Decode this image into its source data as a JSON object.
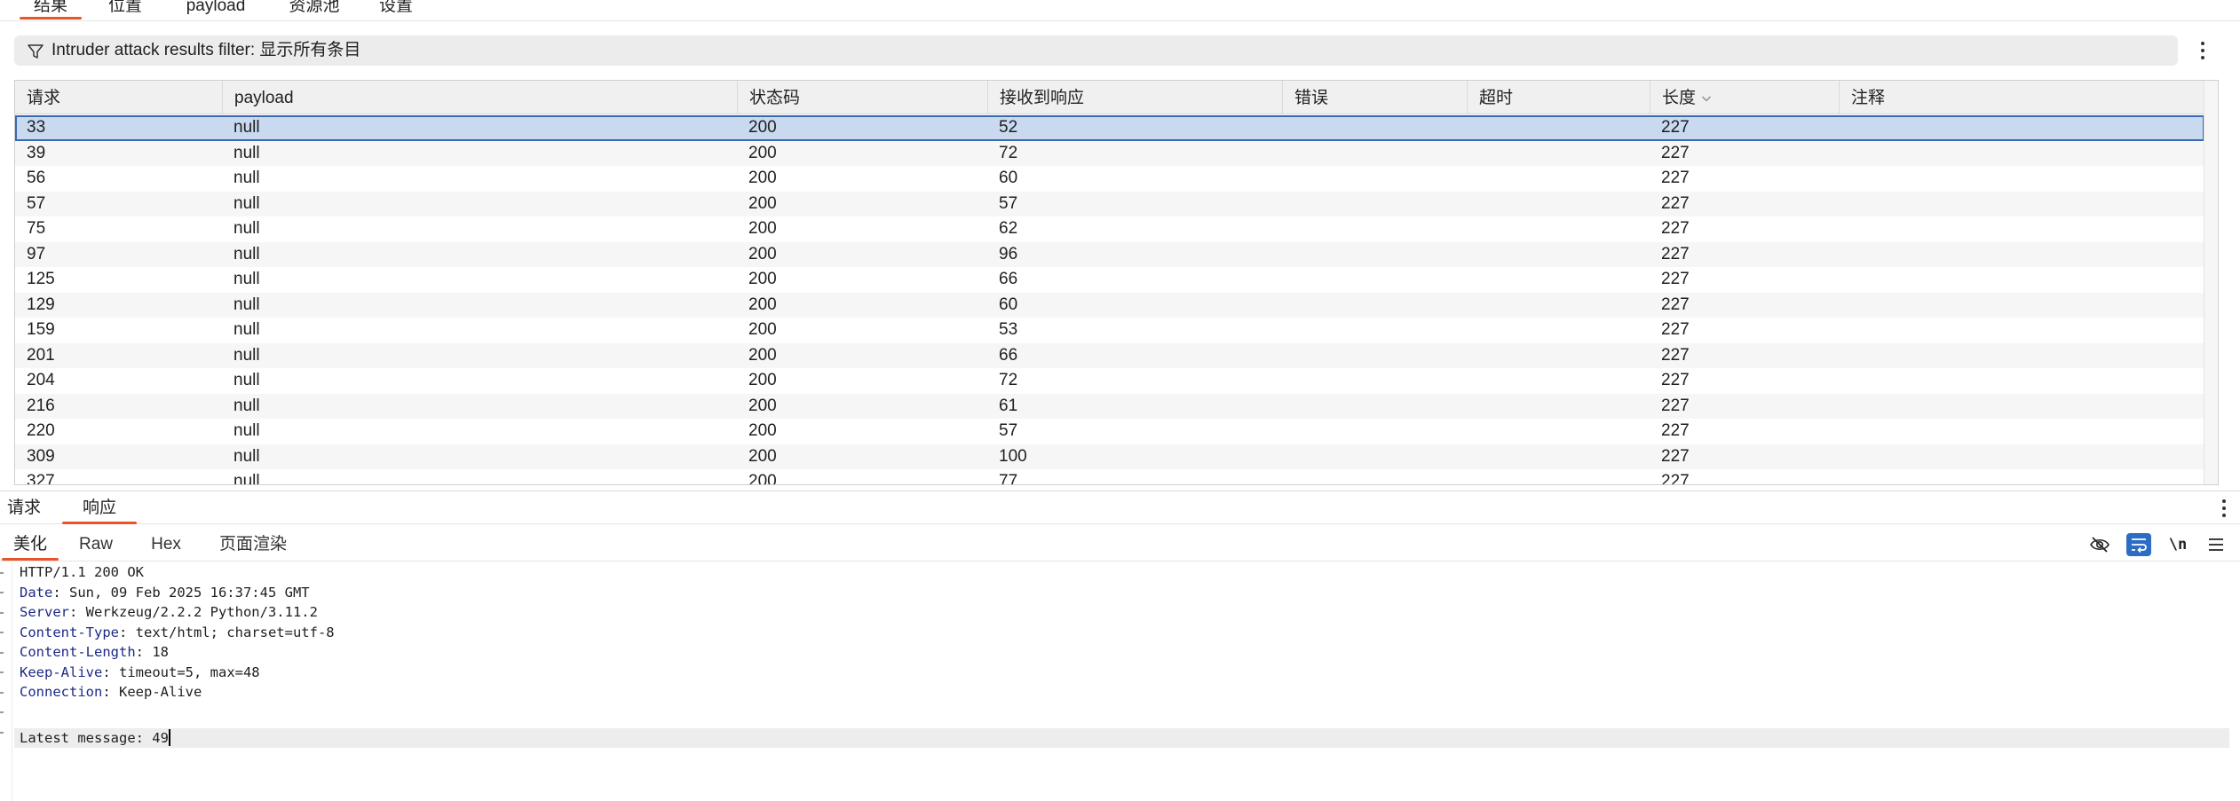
{
  "top_tabs": [
    {
      "label": "结果",
      "active": true
    },
    {
      "label": "位置",
      "active": false
    },
    {
      "label": "payload",
      "active": false
    },
    {
      "label": "资源池",
      "active": false
    },
    {
      "label": "设置",
      "active": false
    }
  ],
  "filter": {
    "text": "Intruder attack results filter: 显示所有条目",
    "icon": "filter-icon"
  },
  "table": {
    "columns": [
      "请求",
      "payload",
      "状态码",
      "接收到响应",
      "错误",
      "超时",
      "长度",
      "注释"
    ],
    "sorted_column": "长度",
    "rows": [
      {
        "request": "33",
        "payload": "null",
        "status": "200",
        "received": "52",
        "error": "",
        "timeout": "",
        "length": "227",
        "comment": "",
        "selected": true
      },
      {
        "request": "39",
        "payload": "null",
        "status": "200",
        "received": "72",
        "error": "",
        "timeout": "",
        "length": "227",
        "comment": ""
      },
      {
        "request": "56",
        "payload": "null",
        "status": "200",
        "received": "60",
        "error": "",
        "timeout": "",
        "length": "227",
        "comment": ""
      },
      {
        "request": "57",
        "payload": "null",
        "status": "200",
        "received": "57",
        "error": "",
        "timeout": "",
        "length": "227",
        "comment": ""
      },
      {
        "request": "75",
        "payload": "null",
        "status": "200",
        "received": "62",
        "error": "",
        "timeout": "",
        "length": "227",
        "comment": ""
      },
      {
        "request": "97",
        "payload": "null",
        "status": "200",
        "received": "96",
        "error": "",
        "timeout": "",
        "length": "227",
        "comment": ""
      },
      {
        "request": "125",
        "payload": "null",
        "status": "200",
        "received": "66",
        "error": "",
        "timeout": "",
        "length": "227",
        "comment": ""
      },
      {
        "request": "129",
        "payload": "null",
        "status": "200",
        "received": "60",
        "error": "",
        "timeout": "",
        "length": "227",
        "comment": ""
      },
      {
        "request": "159",
        "payload": "null",
        "status": "200",
        "received": "53",
        "error": "",
        "timeout": "",
        "length": "227",
        "comment": ""
      },
      {
        "request": "201",
        "payload": "null",
        "status": "200",
        "received": "66",
        "error": "",
        "timeout": "",
        "length": "227",
        "comment": ""
      },
      {
        "request": "204",
        "payload": "null",
        "status": "200",
        "received": "72",
        "error": "",
        "timeout": "",
        "length": "227",
        "comment": ""
      },
      {
        "request": "216",
        "payload": "null",
        "status": "200",
        "received": "61",
        "error": "",
        "timeout": "",
        "length": "227",
        "comment": ""
      },
      {
        "request": "220",
        "payload": "null",
        "status": "200",
        "received": "57",
        "error": "",
        "timeout": "",
        "length": "227",
        "comment": ""
      },
      {
        "request": "309",
        "payload": "null",
        "status": "200",
        "received": "100",
        "error": "",
        "timeout": "",
        "length": "227",
        "comment": ""
      },
      {
        "request": "327",
        "payload": "null",
        "status": "200",
        "received": "77",
        "error": "",
        "timeout": "",
        "length": "227",
        "comment": ""
      }
    ]
  },
  "lower_tabs": [
    {
      "label": "请求",
      "active": false
    },
    {
      "label": "响应",
      "active": true
    }
  ],
  "view_tabs": [
    {
      "label": "美化",
      "active": true
    },
    {
      "label": "Raw",
      "active": false
    },
    {
      "label": "Hex",
      "active": false
    },
    {
      "label": "页面渲染",
      "active": false
    }
  ],
  "toolbar": {
    "hide_icon": "eye-slash-icon",
    "wrap_icon": "word-wrap-icon",
    "newline_label": "\\n",
    "menu_icon": "hamburger-menu-icon"
  },
  "response": {
    "status_line": "HTTP/1.1 200 OK",
    "headers": [
      {
        "name": "Date",
        "value": "Sun, 09 Feb 2025 16:37:45 GMT"
      },
      {
        "name": "Server",
        "value": "Werkzeug/2.2.2 Python/3.11.2"
      },
      {
        "name": "Content-Type",
        "value": "text/html; charset=utf-8"
      },
      {
        "name": "Content-Length",
        "value": "18"
      },
      {
        "name": "Keep-Alive",
        "value": "timeout=5, max=48"
      },
      {
        "name": "Connection",
        "value": "Keep-Alive"
      }
    ],
    "body": "Latest message: 49"
  },
  "colors": {
    "accent": "#e8552d",
    "selection": "#c9d9ef",
    "selection_border": "#3a69b0",
    "header_key": "#1d2a86",
    "toggle_on": "#2b6cc4"
  }
}
